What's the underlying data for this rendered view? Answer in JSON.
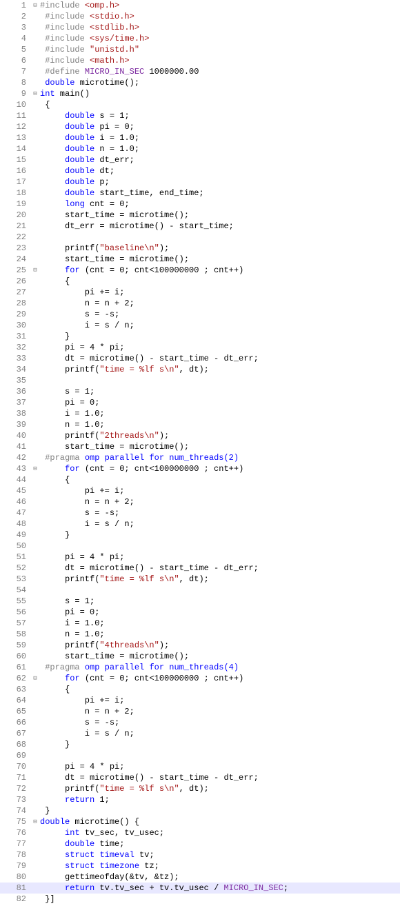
{
  "lines": [
    {
      "n": 1,
      "fold": "⊟",
      "tokens": [
        {
          "t": "#include ",
          "c": "pp"
        },
        {
          "t": "<omp.h>",
          "c": "inc"
        }
      ]
    },
    {
      "n": 2,
      "fold": "",
      "tokens": [
        {
          "t": " "
        },
        {
          "t": "#include ",
          "c": "pp"
        },
        {
          "t": "<stdio.h>",
          "c": "inc"
        }
      ]
    },
    {
      "n": 3,
      "fold": "",
      "tokens": [
        {
          "t": " "
        },
        {
          "t": "#include ",
          "c": "pp"
        },
        {
          "t": "<stdlib.h>",
          "c": "inc"
        }
      ]
    },
    {
      "n": 4,
      "fold": "",
      "tokens": [
        {
          "t": " "
        },
        {
          "t": "#include ",
          "c": "pp"
        },
        {
          "t": "<sys/time.h>",
          "c": "inc"
        }
      ]
    },
    {
      "n": 5,
      "fold": "",
      "tokens": [
        {
          "t": " "
        },
        {
          "t": "#include ",
          "c": "pp"
        },
        {
          "t": "\"unistd.h\"",
          "c": "inc"
        }
      ]
    },
    {
      "n": 6,
      "fold": "",
      "tokens": [
        {
          "t": " "
        },
        {
          "t": "#include ",
          "c": "pp"
        },
        {
          "t": "<math.h>",
          "c": "inc"
        }
      ]
    },
    {
      "n": 7,
      "fold": "",
      "tokens": [
        {
          "t": " "
        },
        {
          "t": "#define ",
          "c": "pp"
        },
        {
          "t": "MICRO_IN_SEC",
          "c": "mac"
        },
        {
          "t": " 1000000.00"
        }
      ]
    },
    {
      "n": 8,
      "fold": "",
      "tokens": [
        {
          "t": " "
        },
        {
          "t": "double",
          "c": "kw"
        },
        {
          "t": " microtime();"
        }
      ]
    },
    {
      "n": 9,
      "fold": "⊟",
      "tokens": [
        {
          "t": "int",
          "c": "kw"
        },
        {
          "t": " main()"
        }
      ]
    },
    {
      "n": 10,
      "fold": "",
      "tokens": [
        {
          "t": " {"
        }
      ]
    },
    {
      "n": 11,
      "fold": "",
      "tokens": [
        {
          "t": "     "
        },
        {
          "t": "double",
          "c": "kw"
        },
        {
          "t": " s = 1;"
        }
      ]
    },
    {
      "n": 12,
      "fold": "",
      "tokens": [
        {
          "t": "     "
        },
        {
          "t": "double",
          "c": "kw"
        },
        {
          "t": " pi = 0;"
        }
      ]
    },
    {
      "n": 13,
      "fold": "",
      "tokens": [
        {
          "t": "     "
        },
        {
          "t": "double",
          "c": "kw"
        },
        {
          "t": " i = 1.0;"
        }
      ]
    },
    {
      "n": 14,
      "fold": "",
      "tokens": [
        {
          "t": "     "
        },
        {
          "t": "double",
          "c": "kw"
        },
        {
          "t": " n = 1.0;"
        }
      ]
    },
    {
      "n": 15,
      "fold": "",
      "tokens": [
        {
          "t": "     "
        },
        {
          "t": "double",
          "c": "kw"
        },
        {
          "t": " dt_err;"
        }
      ]
    },
    {
      "n": 16,
      "fold": "",
      "tokens": [
        {
          "t": "     "
        },
        {
          "t": "double",
          "c": "kw"
        },
        {
          "t": " dt;"
        }
      ]
    },
    {
      "n": 17,
      "fold": "",
      "tokens": [
        {
          "t": "     "
        },
        {
          "t": "double",
          "c": "kw"
        },
        {
          "t": " p;"
        }
      ]
    },
    {
      "n": 18,
      "fold": "",
      "tokens": [
        {
          "t": "     "
        },
        {
          "t": "double",
          "c": "kw"
        },
        {
          "t": " start_time, end_time;"
        }
      ]
    },
    {
      "n": 19,
      "fold": "",
      "tokens": [
        {
          "t": "     "
        },
        {
          "t": "long",
          "c": "kw"
        },
        {
          "t": " cnt = 0;"
        }
      ]
    },
    {
      "n": 20,
      "fold": "",
      "tokens": [
        {
          "t": "     start_time = microtime();"
        }
      ]
    },
    {
      "n": 21,
      "fold": "",
      "tokens": [
        {
          "t": "     dt_err = microtime() - start_time;"
        }
      ]
    },
    {
      "n": 22,
      "fold": "",
      "tokens": []
    },
    {
      "n": 23,
      "fold": "",
      "tokens": [
        {
          "t": "     printf("
        },
        {
          "t": "\"baseline\\n\"",
          "c": "str"
        },
        {
          "t": ");"
        }
      ]
    },
    {
      "n": 24,
      "fold": "",
      "tokens": [
        {
          "t": "     start_time = microtime();"
        }
      ]
    },
    {
      "n": 25,
      "fold": "⊟",
      "tokens": [
        {
          "t": "     "
        },
        {
          "t": "for",
          "c": "kw"
        },
        {
          "t": " (cnt = 0; cnt<100000000 ; cnt++)"
        }
      ]
    },
    {
      "n": 26,
      "fold": "",
      "tokens": [
        {
          "t": "     {"
        }
      ]
    },
    {
      "n": 27,
      "fold": "",
      "tokens": [
        {
          "t": "         pi += i;"
        }
      ]
    },
    {
      "n": 28,
      "fold": "",
      "tokens": [
        {
          "t": "         n = n + 2;"
        }
      ]
    },
    {
      "n": 29,
      "fold": "",
      "tokens": [
        {
          "t": "         s = -s;"
        }
      ]
    },
    {
      "n": 30,
      "fold": "",
      "tokens": [
        {
          "t": "         i = s / n;"
        }
      ]
    },
    {
      "n": 31,
      "fold": "",
      "tokens": [
        {
          "t": "     }"
        }
      ]
    },
    {
      "n": 32,
      "fold": "",
      "tokens": [
        {
          "t": "     pi = 4 * pi;"
        }
      ]
    },
    {
      "n": 33,
      "fold": "",
      "tokens": [
        {
          "t": "     dt = microtime() - start_time - dt_err;"
        }
      ]
    },
    {
      "n": 34,
      "fold": "",
      "tokens": [
        {
          "t": "     printf("
        },
        {
          "t": "\"time = %lf s\\n\"",
          "c": "str"
        },
        {
          "t": ", dt);"
        }
      ]
    },
    {
      "n": 35,
      "fold": "",
      "tokens": []
    },
    {
      "n": 36,
      "fold": "",
      "tokens": [
        {
          "t": "     s = 1;"
        }
      ]
    },
    {
      "n": 37,
      "fold": "",
      "tokens": [
        {
          "t": "     pi = 0;"
        }
      ]
    },
    {
      "n": 38,
      "fold": "",
      "tokens": [
        {
          "t": "     i = 1.0;"
        }
      ]
    },
    {
      "n": 39,
      "fold": "",
      "tokens": [
        {
          "t": "     n = 1.0;"
        }
      ]
    },
    {
      "n": 40,
      "fold": "",
      "tokens": [
        {
          "t": "     printf("
        },
        {
          "t": "\"2threads\\n\"",
          "c": "str"
        },
        {
          "t": ");"
        }
      ]
    },
    {
      "n": 41,
      "fold": "",
      "tokens": [
        {
          "t": "     start_time = microtime();"
        }
      ]
    },
    {
      "n": 42,
      "fold": "",
      "tokens": [
        {
          "t": " "
        },
        {
          "t": "#pragma",
          "c": "pp"
        },
        {
          "t": " omp parallel ",
          "c": "pragma-name"
        },
        {
          "t": "for",
          "c": "kw"
        },
        {
          "t": " num_threads(2)",
          "c": "pragma-name"
        }
      ]
    },
    {
      "n": 43,
      "fold": "⊟",
      "tokens": [
        {
          "t": "     "
        },
        {
          "t": "for",
          "c": "kw"
        },
        {
          "t": " (cnt = 0; cnt<100000000 ; cnt++)"
        }
      ]
    },
    {
      "n": 44,
      "fold": "",
      "tokens": [
        {
          "t": "     {"
        }
      ]
    },
    {
      "n": 45,
      "fold": "",
      "tokens": [
        {
          "t": "         pi += i;"
        }
      ]
    },
    {
      "n": 46,
      "fold": "",
      "tokens": [
        {
          "t": "         n = n + 2;"
        }
      ]
    },
    {
      "n": 47,
      "fold": "",
      "tokens": [
        {
          "t": "         s = -s;"
        }
      ]
    },
    {
      "n": 48,
      "fold": "",
      "tokens": [
        {
          "t": "         i = s / n;"
        }
      ]
    },
    {
      "n": 49,
      "fold": "",
      "tokens": [
        {
          "t": "     }"
        }
      ]
    },
    {
      "n": 50,
      "fold": "",
      "tokens": []
    },
    {
      "n": 51,
      "fold": "",
      "tokens": [
        {
          "t": "     pi = 4 * pi;"
        }
      ]
    },
    {
      "n": 52,
      "fold": "",
      "tokens": [
        {
          "t": "     dt = microtime() - start_time - dt_err;"
        }
      ]
    },
    {
      "n": 53,
      "fold": "",
      "tokens": [
        {
          "t": "     printf("
        },
        {
          "t": "\"time = %lf s\\n\"",
          "c": "str"
        },
        {
          "t": ", dt);"
        }
      ]
    },
    {
      "n": 54,
      "fold": "",
      "tokens": []
    },
    {
      "n": 55,
      "fold": "",
      "tokens": [
        {
          "t": "     s = 1;"
        }
      ]
    },
    {
      "n": 56,
      "fold": "",
      "tokens": [
        {
          "t": "     pi = 0;"
        }
      ]
    },
    {
      "n": 57,
      "fold": "",
      "tokens": [
        {
          "t": "     i = 1.0;"
        }
      ]
    },
    {
      "n": 58,
      "fold": "",
      "tokens": [
        {
          "t": "     n = 1.0;"
        }
      ]
    },
    {
      "n": 59,
      "fold": "",
      "tokens": [
        {
          "t": "     printf("
        },
        {
          "t": "\"4threads\\n\"",
          "c": "str"
        },
        {
          "t": ");"
        }
      ]
    },
    {
      "n": 60,
      "fold": "",
      "tokens": [
        {
          "t": "     start_time = microtime();"
        }
      ]
    },
    {
      "n": 61,
      "fold": "",
      "tokens": [
        {
          "t": " "
        },
        {
          "t": "#pragma",
          "c": "pp"
        },
        {
          "t": " omp parallel ",
          "c": "pragma-name"
        },
        {
          "t": "for",
          "c": "kw"
        },
        {
          "t": " num_threads(4)",
          "c": "pragma-name"
        }
      ]
    },
    {
      "n": 62,
      "fold": "⊟",
      "tokens": [
        {
          "t": "     "
        },
        {
          "t": "for",
          "c": "kw"
        },
        {
          "t": " (cnt = 0; cnt<100000000 ; cnt++)"
        }
      ]
    },
    {
      "n": 63,
      "fold": "",
      "tokens": [
        {
          "t": "     {"
        }
      ]
    },
    {
      "n": 64,
      "fold": "",
      "tokens": [
        {
          "t": "         pi += i;"
        }
      ]
    },
    {
      "n": 65,
      "fold": "",
      "tokens": [
        {
          "t": "         n = n + 2;"
        }
      ]
    },
    {
      "n": 66,
      "fold": "",
      "tokens": [
        {
          "t": "         s = -s;"
        }
      ]
    },
    {
      "n": 67,
      "fold": "",
      "tokens": [
        {
          "t": "         i = s / n;"
        }
      ]
    },
    {
      "n": 68,
      "fold": "",
      "tokens": [
        {
          "t": "     }"
        }
      ]
    },
    {
      "n": 69,
      "fold": "",
      "tokens": []
    },
    {
      "n": 70,
      "fold": "",
      "tokens": [
        {
          "t": "     pi = 4 * pi;"
        }
      ]
    },
    {
      "n": 71,
      "fold": "",
      "tokens": [
        {
          "t": "     dt = microtime() - start_time - dt_err;"
        }
      ]
    },
    {
      "n": 72,
      "fold": "",
      "tokens": [
        {
          "t": "     printf("
        },
        {
          "t": "\"time = %lf s\\n\"",
          "c": "str"
        },
        {
          "t": ", dt);"
        }
      ]
    },
    {
      "n": 73,
      "fold": "",
      "tokens": [
        {
          "t": "     "
        },
        {
          "t": "return",
          "c": "kw"
        },
        {
          "t": " 1;"
        }
      ]
    },
    {
      "n": 74,
      "fold": "",
      "tokens": [
        {
          "t": " }"
        }
      ]
    },
    {
      "n": 75,
      "fold": "⊟",
      "tokens": [
        {
          "t": "double",
          "c": "kw"
        },
        {
          "t": " microtime() {"
        }
      ]
    },
    {
      "n": 76,
      "fold": "",
      "tokens": [
        {
          "t": "     "
        },
        {
          "t": "int",
          "c": "kw"
        },
        {
          "t": " tv_sec, tv_usec;"
        }
      ]
    },
    {
      "n": 77,
      "fold": "",
      "tokens": [
        {
          "t": "     "
        },
        {
          "t": "double",
          "c": "kw"
        },
        {
          "t": " time;"
        }
      ]
    },
    {
      "n": 78,
      "fold": "",
      "tokens": [
        {
          "t": "     "
        },
        {
          "t": "struct",
          "c": "kw"
        },
        {
          "t": " "
        },
        {
          "t": "timeval",
          "c": "pragma-name"
        },
        {
          "t": " tv;"
        }
      ]
    },
    {
      "n": 79,
      "fold": "",
      "tokens": [
        {
          "t": "     "
        },
        {
          "t": "struct",
          "c": "kw"
        },
        {
          "t": " "
        },
        {
          "t": "timezone",
          "c": "pragma-name"
        },
        {
          "t": " tz;"
        }
      ]
    },
    {
      "n": 80,
      "fold": "",
      "tokens": [
        {
          "t": "     gettimeofday(&tv, &tz);"
        }
      ]
    },
    {
      "n": 81,
      "fold": "",
      "hl": true,
      "tokens": [
        {
          "t": "     "
        },
        {
          "t": "return",
          "c": "kw"
        },
        {
          "t": " tv.tv_sec + tv.tv_usec / "
        },
        {
          "t": "MICRO_IN_SEC",
          "c": "mac"
        },
        {
          "t": ";"
        }
      ]
    },
    {
      "n": 82,
      "fold": "",
      "tokens": [
        {
          "t": " }"
        },
        {
          "t": "]"
        }
      ]
    }
  ]
}
